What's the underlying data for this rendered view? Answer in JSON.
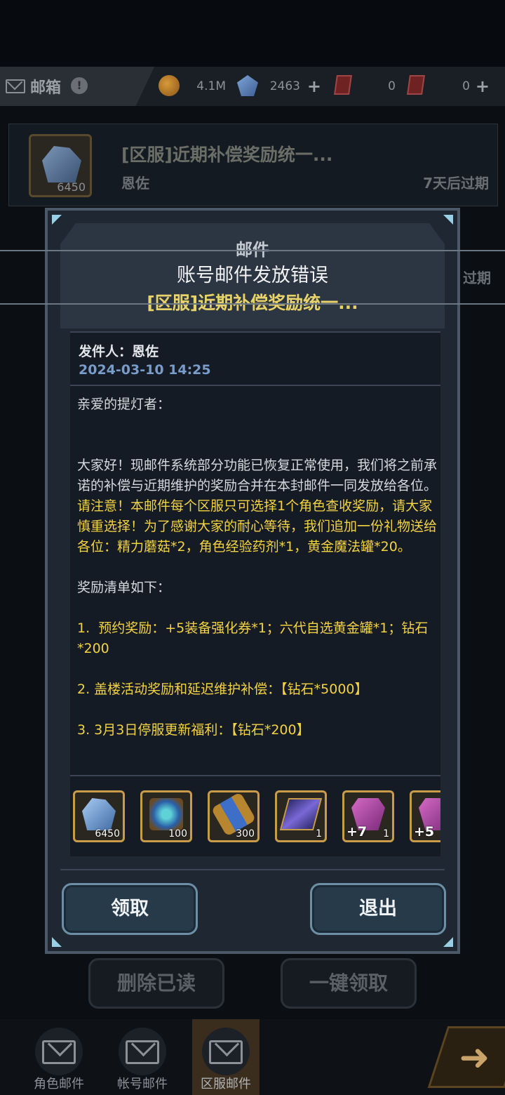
{
  "topbar": {
    "title": "邮箱",
    "info_icon": "info-icon",
    "gold": "4.1M",
    "diamonds": "2463",
    "card_a": "0",
    "card_b": "0"
  },
  "mail_list": {
    "item": {
      "subject": "[区服]近期补偿奖励统一...",
      "sender": "恩佐",
      "expiry": "7天后过期",
      "thumb_count": "6450"
    },
    "second_expiry": "过期"
  },
  "modal": {
    "title": "邮件",
    "subject": "[区服]近期补偿奖励统一...",
    "sender_line": "发件人：恩佐",
    "date": "2024-03-10 14:25",
    "body": {
      "greeting": "亲爱的提灯者：",
      "p1": "大家好！现邮件系统部分功能已恢复正常使用，我们将之前承诺的补偿与近期维护的奖励合并在本封邮件一同发放给各位。",
      "p2": "请注意！本邮件每个区服只可选择1个角色查收奖励，请大家慎重选择！为了感谢大家的耐心等待，我们追加一份礼物送给各位：精力蘑菇*2，角色经验药剂*1，黄金魔法罐*20。",
      "list_title": "奖励清单如下：",
      "item1": "1.  预约奖励：+5装备强化券*1；六代自选黄金罐*1；钻石*200",
      "item2": "2. 盖楼活动奖励和延迟维护补偿：【钻石*5000】",
      "item3": "3. 3月3日停服更新福利：【钻石*200】"
    },
    "items": [
      {
        "icon": "diamond-icon",
        "count": "6450",
        "level": ""
      },
      {
        "icon": "treasure-chest-icon",
        "count": "100",
        "level": ""
      },
      {
        "icon": "magic-jar-icon",
        "count": "300",
        "level": ""
      },
      {
        "icon": "scroll-icon",
        "count": "1",
        "level": ""
      },
      {
        "icon": "enhance-ticket-icon",
        "count": "1",
        "level": "+7"
      },
      {
        "icon": "enhance-ticket-icon",
        "count": "",
        "level": "+5"
      }
    ],
    "claim_button": "领取",
    "exit_button": "退出"
  },
  "toast": "账号邮件发放错误",
  "bottom_buttons": {
    "delete_read": "删除已读",
    "claim_all": "一键领取"
  },
  "tabs": [
    {
      "label": "角色邮件",
      "icon": "envelope-icon"
    },
    {
      "label": "帐号邮件",
      "icon": "account-mail-icon"
    },
    {
      "label": "区服邮件",
      "icon": "server-mail-icon"
    }
  ],
  "colors": {
    "accent_yellow": "#f4d342",
    "date_blue": "#7a9ccb",
    "button_border": "#6d8fa6",
    "item_border": "#c99c4a"
  }
}
